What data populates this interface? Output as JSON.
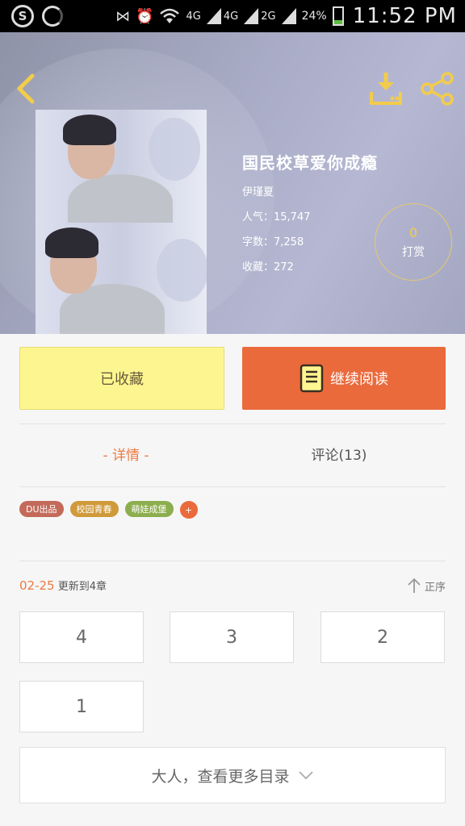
{
  "status_bar": {
    "network_1": "4G",
    "network_2": "4G",
    "network_3": "2G",
    "battery_percent": "24%",
    "time": "11:52 PM",
    "battery_level": 0.24,
    "icons": [
      "sogou-icon",
      "loading-ring-icon",
      "nfc-icon",
      "alarm-icon",
      "wifi-icon",
      "signal-icon",
      "battery-icon"
    ]
  },
  "header": {
    "icons": [
      "back-icon",
      "download-icon",
      "share-icon"
    ],
    "accent_color": "#f2cc4a"
  },
  "book": {
    "title": "国民校草爱你成瘾",
    "author": "伊瑾夏",
    "popularity": "人气：15,747",
    "word_count": "字数：7,258",
    "favorites": "收藏：272",
    "tip_count": "0",
    "tip_label": "打赏"
  },
  "actions": {
    "collected_label": "已收藏",
    "continue_label": "继续阅读",
    "collected_color": "#fdf690",
    "continue_color": "#ea6a3c",
    "continue_icon": "book-icon"
  },
  "tabs": {
    "details": "- 详情 -",
    "comments": "评论(13)"
  },
  "tags": [
    {
      "label": "DU出品",
      "color": "#c36a5a"
    },
    {
      "label": "校园青春",
      "color": "#cf9a3a"
    },
    {
      "label": "萌娃成堡",
      "color": "#8cae4e"
    }
  ],
  "tag_more": "+",
  "updates": {
    "date": "02-25",
    "text": "更新到4章",
    "sort_label": "正序"
  },
  "chapters": [
    "4",
    "3",
    "2",
    "1"
  ],
  "more_catalog": "大人，查看更多目录"
}
